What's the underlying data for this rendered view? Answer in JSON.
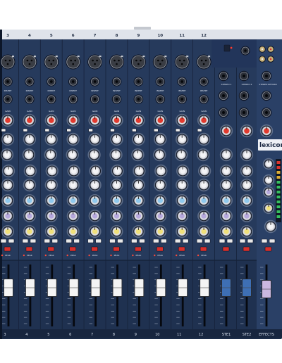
{
  "brand": "lexicon",
  "mono_channels": [
    {
      "number": "3",
      "bottom_label": "3"
    },
    {
      "number": "4",
      "bottom_label": "4"
    },
    {
      "number": "5",
      "bottom_label": "5"
    },
    {
      "number": "6",
      "bottom_label": "6"
    },
    {
      "number": "7",
      "bottom_label": "7"
    },
    {
      "number": "8",
      "bottom_label": "8"
    },
    {
      "number": "9",
      "bottom_label": "9"
    },
    {
      "number": "10",
      "bottom_label": "10"
    },
    {
      "number": "11",
      "bottom_label": "11"
    },
    {
      "number": "12",
      "bottom_label": "12"
    }
  ],
  "stereo_channels": [
    {
      "top_label": "STEREO 1",
      "bottom_label": "STE1"
    },
    {
      "top_label": "STEREO 2",
      "bottom_label": "STE2"
    }
  ],
  "effects": {
    "top_label": "STEREO RETURN",
    "bottom_label": "EFFECTS"
  },
  "strip_labels": {
    "insert": "INSERT",
    "gain": "GAIN",
    "peak": "PEAK"
  },
  "colors": {
    "panel": "#263a5c",
    "panel_dark": "#1c2c48",
    "fader_cap_white": "#f4f4f4",
    "fader_cap_blue": "#3e6fb4",
    "fader_cap_violet": "#cbb8e0",
    "gain_knob": "#e23a2e",
    "eq_blue": "#8fc8ec",
    "eq_violet": "#b6a8dc",
    "pan_yellow": "#f0e07a",
    "button_red": "#d8302c",
    "button_grey": "#e8e8e8",
    "connector_gold": "#c8b27a"
  }
}
